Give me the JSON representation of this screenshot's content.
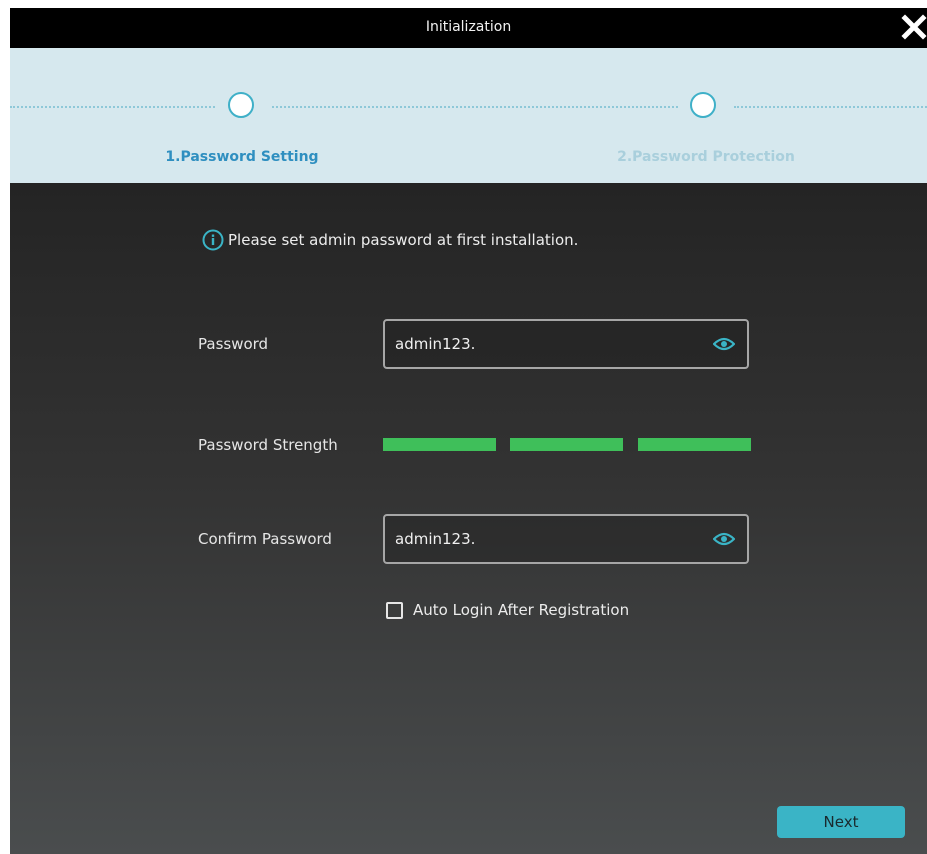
{
  "window": {
    "title": "Initialization"
  },
  "steps": [
    {
      "label": "1.Password Setting",
      "color": "#2f8fc0"
    },
    {
      "label": "2.Password Protection",
      "color": "#a9cfdc"
    }
  ],
  "info": {
    "message": "Please set admin password at first installation."
  },
  "form": {
    "password_label": "Password",
    "password_value": "admin123.",
    "strength_label": "Password Strength",
    "strength_levels_filled": 3,
    "strength_levels_total": 3,
    "strength_color": "#3fbf5a",
    "confirm_label": "Confirm Password",
    "confirm_value": "admin123.",
    "auto_login_label": "Auto Login After Registration",
    "auto_login_checked": false
  },
  "buttons": {
    "next_label": "Next"
  },
  "colors": {
    "accent": "#3ab4c6",
    "titlebar": "#000000",
    "stepbar": "#d6e8ee"
  }
}
